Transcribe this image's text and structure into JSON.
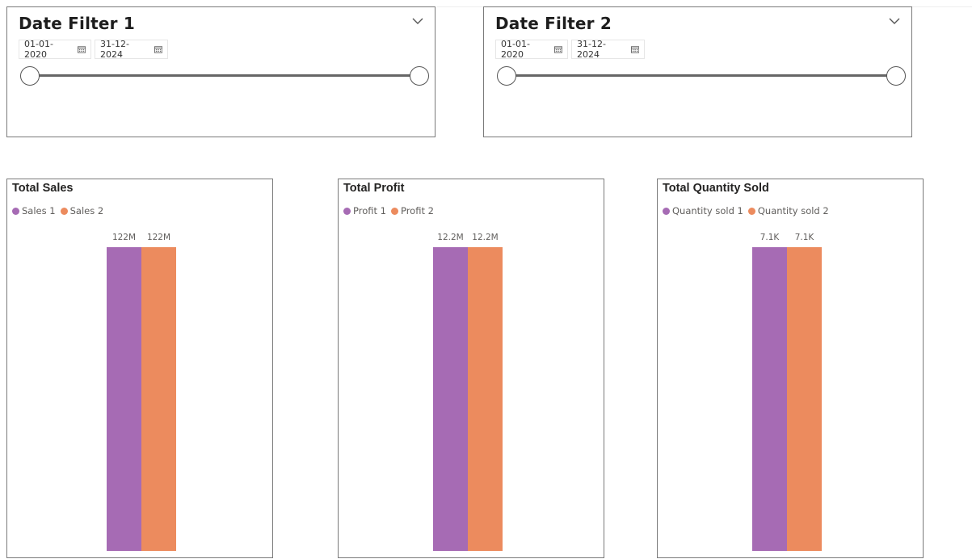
{
  "filters": [
    {
      "title": "Date Filter 1",
      "start_date": "01-01-2020",
      "end_date": "31-12-2024",
      "range_start_fraction": 0,
      "range_end_fraction": 1,
      "icons": {
        "dropdown": "chevron-down-icon",
        "calendar": "calendar-icon"
      }
    },
    {
      "title": "Date Filter 2",
      "start_date": "01-01-2020",
      "end_date": "31-12-2024",
      "range_start_fraction": 0,
      "range_end_fraction": 1,
      "icons": {
        "dropdown": "chevron-down-icon",
        "calendar": "calendar-icon"
      }
    }
  ],
  "colors": {
    "series_1": "#a66bb4",
    "series_2": "#ec8b5e"
  },
  "chart_data": [
    {
      "type": "bar",
      "title": "Total Sales",
      "legend_placement": "top-left",
      "grid": false,
      "series": [
        {
          "name": "Sales 1",
          "value": 122,
          "label": "122M"
        },
        {
          "name": "Sales 2",
          "value": 122,
          "label": "122M"
        }
      ]
    },
    {
      "type": "bar",
      "title": "Total Profit",
      "legend_placement": "top-left",
      "grid": false,
      "series": [
        {
          "name": "Profit 1",
          "value": 12.2,
          "label": "12.2M"
        },
        {
          "name": "Profit 2",
          "value": 12.2,
          "label": "12.2M"
        }
      ]
    },
    {
      "type": "bar",
      "title": "Total Quantity Sold",
      "legend_placement": "top-left",
      "grid": false,
      "series": [
        {
          "name": "Quantity sold 1",
          "value": 7.1,
          "label": "7.1K"
        },
        {
          "name": "Quantity sold 2",
          "value": 7.1,
          "label": "7.1K"
        }
      ]
    }
  ]
}
